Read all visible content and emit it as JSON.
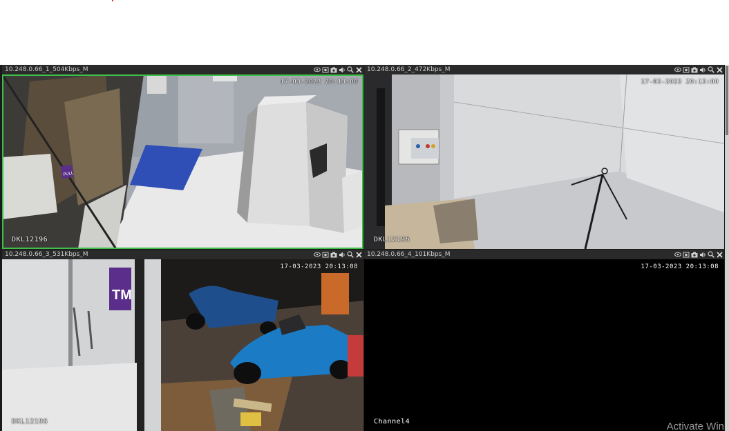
{
  "tiles": [
    {
      "title": "10.248.0.66_1_504Kbps_M",
      "timestamp": "17-03-2023 20:13:00",
      "label": "DKL12196"
    },
    {
      "title": "10.248.0.66_2_472Kbps_M",
      "timestamp": "17-03-2023 20:13:00",
      "label": "DKL12196"
    },
    {
      "title": "10.248.0.66_3_531Kbps_M",
      "timestamp": "17-03-2023 20:13:08",
      "label": "DKL12196"
    },
    {
      "title": "10.248.0.66_4_101Kbps_M",
      "timestamp": "17-03-2023 20:13:08",
      "label": "Channel4"
    }
  ],
  "scene": {
    "door_sign": "PULL",
    "banner_text": "TM"
  },
  "toolbar_icons": [
    "eye-icon",
    "record-icon",
    "camera-icon",
    "speaker-icon",
    "zoom-icon",
    "close-icon"
  ],
  "watermark": "Activate Win",
  "colors": {
    "selected_border": "#3fbf4a"
  }
}
